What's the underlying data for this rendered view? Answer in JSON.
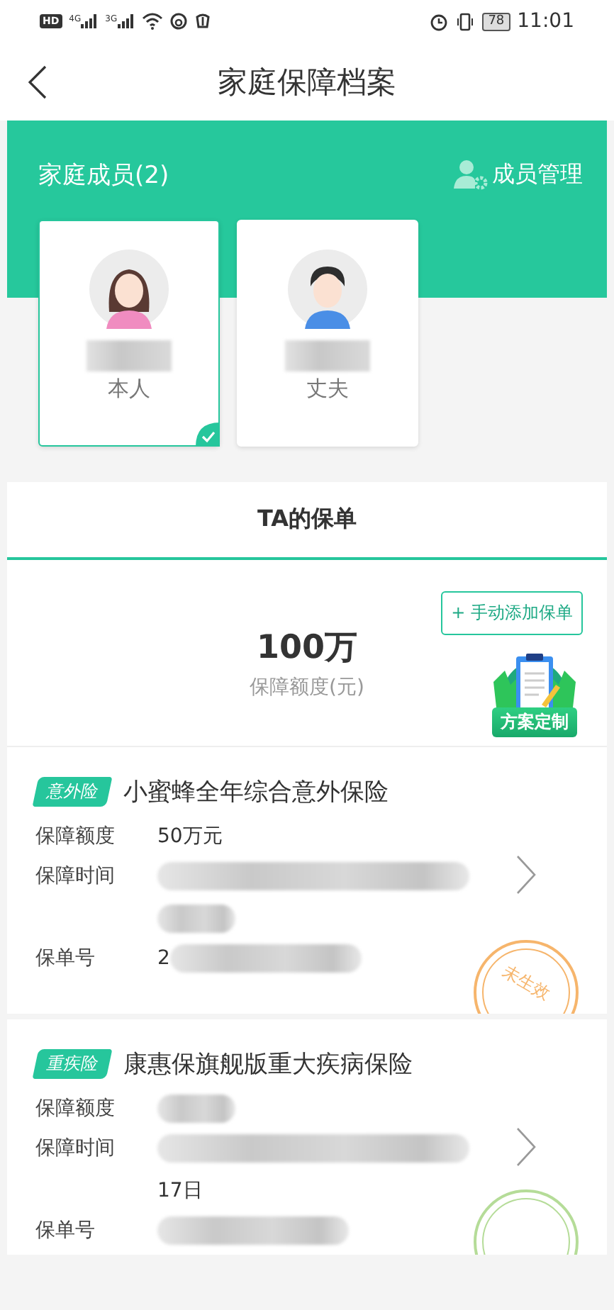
{
  "status_bar": {
    "hd": "HD",
    "networks": [
      "4G",
      "3G"
    ],
    "battery": "78",
    "time": "11:01"
  },
  "nav": {
    "title": "家庭保障档案"
  },
  "members": {
    "title": "家庭成员(2)",
    "manage": "成员管理",
    "items": [
      {
        "kind": "female",
        "relation": "本人",
        "selected": true
      },
      {
        "kind": "male",
        "relation": "丈夫",
        "selected": false
      }
    ]
  },
  "tabs": [
    {
      "label": "TA的保单",
      "selected": true
    }
  ],
  "summary": {
    "add_button": "+ 手动添加保单",
    "amount": "100万",
    "amount_label": "保障额度(元)",
    "promo": "方案定制"
  },
  "policies": [
    {
      "tag": "意外险",
      "name": "小蜜蜂全年综合意外保险",
      "stamp": {
        "text": "未生效",
        "color": "#f6b56c"
      },
      "rows": [
        {
          "label": "保障额度",
          "lines": [
            [
              {
                "kind": "text",
                "text": "50万元"
              }
            ]
          ]
        },
        {
          "label": "保障时间",
          "lines": [
            [
              {
                "kind": "blur_long"
              }
            ],
            [
              {
                "kind": "blur_short"
              }
            ]
          ]
        },
        {
          "label": "保单号",
          "lines": [
            [
              {
                "kind": "text",
                "text": "2"
              },
              {
                "kind": "blur_mid"
              }
            ]
          ]
        }
      ]
    },
    {
      "tag": "重疾险",
      "name": "康惠保旗舰版重大疾病保险",
      "stamp": {
        "color": "#b5dc98"
      },
      "rows": [
        {
          "label": "保障额度",
          "lines": [
            [
              {
                "kind": "blur_short"
              }
            ]
          ]
        },
        {
          "label": "保障时间",
          "lines": [
            [
              {
                "kind": "blur_long"
              }
            ],
            [
              {
                "kind": "text",
                "text": "17日"
              }
            ]
          ]
        },
        {
          "label": "保单号",
          "lines": [
            [
              {
                "kind": "blur_mid"
              }
            ]
          ]
        }
      ]
    }
  ]
}
